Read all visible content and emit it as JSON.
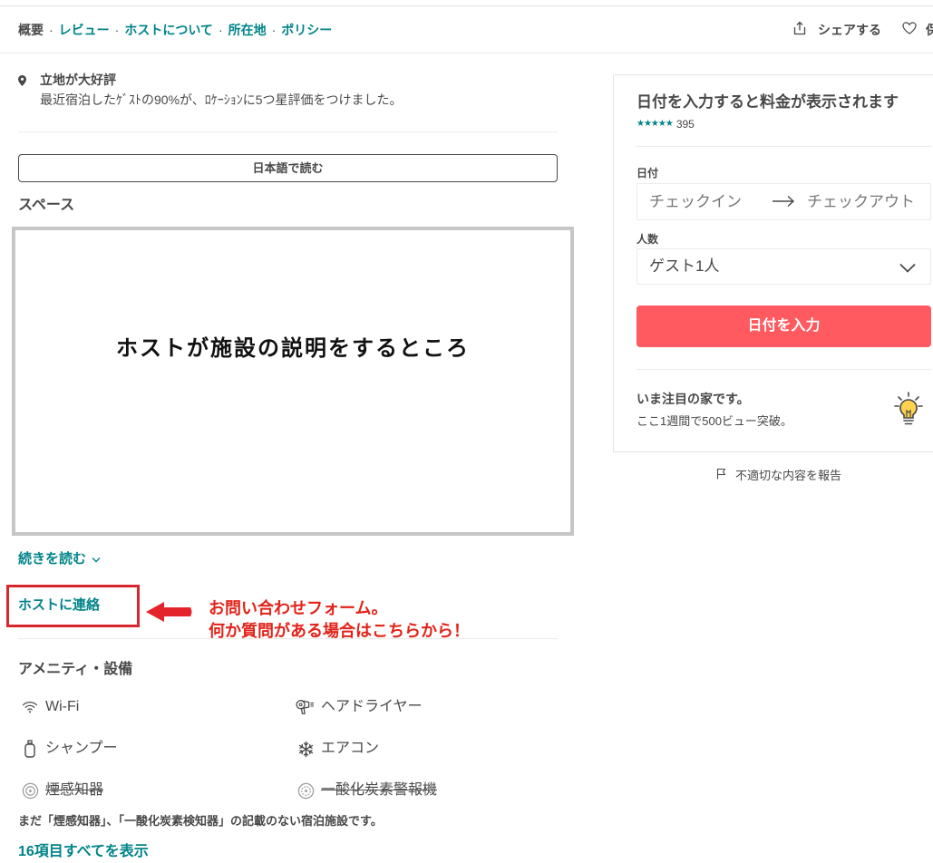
{
  "nav": {
    "items": [
      {
        "label": "概要",
        "active": true
      },
      {
        "label": "レビュー",
        "active": false
      },
      {
        "label": "ホストについて",
        "active": false
      },
      {
        "label": "所在地",
        "active": false
      },
      {
        "label": "ポリシー",
        "active": false
      }
    ],
    "separator": "·",
    "share_label": "シェアする",
    "share_icon": "share-icon",
    "save_label": "保",
    "save_icon": "heart-icon"
  },
  "highlight": {
    "icon": "map-pin-icon",
    "title": "立地が大好評",
    "text": "最近宿泊したｹﾞｽﾄの90%が、ﾛｹｰｼｮﾝに5つ星評価をつけました。"
  },
  "translate_button": "日本語で読む",
  "space": {
    "heading": "スペース",
    "description": "ホストが施設の説明をするところ",
    "read_more": "続きを読む",
    "read_more_icon": "chevron-down-icon"
  },
  "contact_host": "ホストに連絡",
  "annotation": {
    "line1": "お問い合わせフォーム。",
    "line2": "何か質問がある場合はこちらから！",
    "arrow_icon": "arrow-left-icon"
  },
  "amenities": {
    "heading": "アメニティ・設備",
    "items": [
      {
        "label": "Wi-Fi",
        "icon": "wifi-icon",
        "available": true
      },
      {
        "label": "ヘアドライヤー",
        "icon": "hair-dryer-icon",
        "available": true
      },
      {
        "label": "シャンプー",
        "icon": "shampoo-icon",
        "available": true
      },
      {
        "label": "エアコン",
        "icon": "snowflake-icon",
        "available": true
      },
      {
        "label": "煙感知器",
        "icon": "smoke-detector-icon",
        "available": false
      },
      {
        "label": "一酸化炭素警報機",
        "icon": "co-detector-icon",
        "available": false
      }
    ],
    "note": "まだ「煙感知器」、「一酸化炭素検知器」の記載のない宿泊施設です。",
    "show_all": "16項目すべてを表示"
  },
  "booking": {
    "title": "日付を入力すると料金が表示されます",
    "stars": "★★★★★",
    "review_count": "395",
    "dates_label": "日付",
    "checkin_placeholder": "チェックイン",
    "checkout_placeholder": "チェックアウト",
    "guests_label": "人数",
    "guests_value": "ゲスト1人",
    "submit": "日付を入力",
    "popular_title": "いま注目の家です。",
    "popular_text": "ここ1週間で500ビュー突破。",
    "popular_icon": "light-bulb-icon"
  },
  "report": {
    "icon": "flag-icon",
    "label": "不適切な内容を報告"
  },
  "colors": {
    "teal": "#008489",
    "text": "#484848",
    "primary_button": "#FF5A5F",
    "annotation_red": "#E2231A"
  }
}
